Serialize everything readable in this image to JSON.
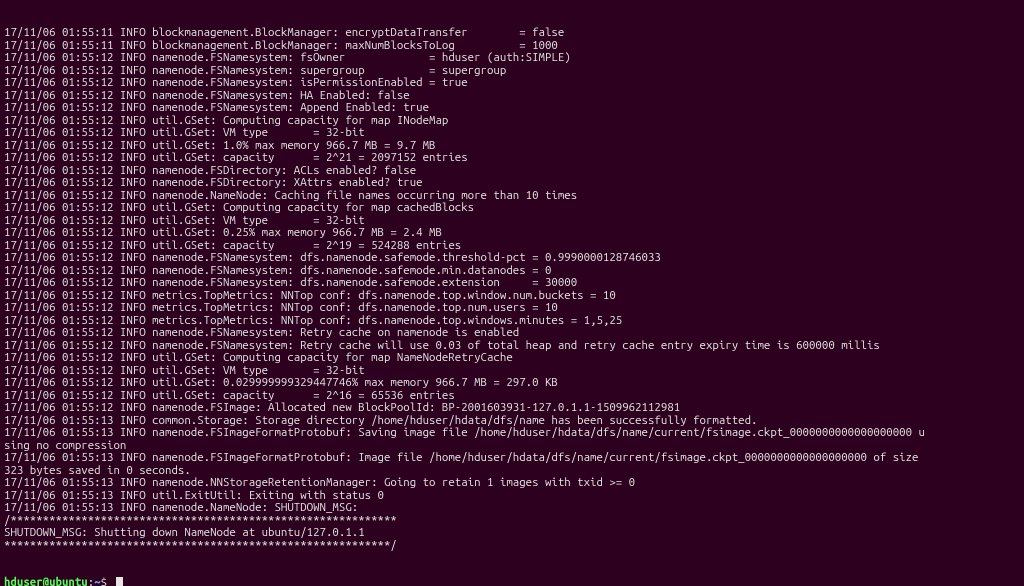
{
  "terminal": {
    "lines": [
      "17/11/06 01:55:11 INFO blockmanagement.BlockManager: encryptDataTransfer        = false",
      "17/11/06 01:55:11 INFO blockmanagement.BlockManager: maxNumBlocksToLog          = 1000",
      "17/11/06 01:55:12 INFO namenode.FSNamesystem: fsOwner             = hduser (auth:SIMPLE)",
      "17/11/06 01:55:12 INFO namenode.FSNamesystem: supergroup          = supergroup",
      "17/11/06 01:55:12 INFO namenode.FSNamesystem: isPermissionEnabled = true",
      "17/11/06 01:55:12 INFO namenode.FSNamesystem: HA Enabled: false",
      "17/11/06 01:55:12 INFO namenode.FSNamesystem: Append Enabled: true",
      "17/11/06 01:55:12 INFO util.GSet: Computing capacity for map INodeMap",
      "17/11/06 01:55:12 INFO util.GSet: VM type       = 32-bit",
      "17/11/06 01:55:12 INFO util.GSet: 1.0% max memory 966.7 MB = 9.7 MB",
      "17/11/06 01:55:12 INFO util.GSet: capacity      = 2^21 = 2097152 entries",
      "17/11/06 01:55:12 INFO namenode.FSDirectory: ACLs enabled? false",
      "17/11/06 01:55:12 INFO namenode.FSDirectory: XAttrs enabled? true",
      "17/11/06 01:55:12 INFO namenode.NameNode: Caching file names occurring more than 10 times",
      "17/11/06 01:55:12 INFO util.GSet: Computing capacity for map cachedBlocks",
      "17/11/06 01:55:12 INFO util.GSet: VM type       = 32-bit",
      "17/11/06 01:55:12 INFO util.GSet: 0.25% max memory 966.7 MB = 2.4 MB",
      "17/11/06 01:55:12 INFO util.GSet: capacity      = 2^19 = 524288 entries",
      "17/11/06 01:55:12 INFO namenode.FSNamesystem: dfs.namenode.safemode.threshold-pct = 0.9990000128746033",
      "17/11/06 01:55:12 INFO namenode.FSNamesystem: dfs.namenode.safemode.min.datanodes = 0",
      "17/11/06 01:55:12 INFO namenode.FSNamesystem: dfs.namenode.safemode.extension     = 30000",
      "17/11/06 01:55:12 INFO metrics.TopMetrics: NNTop conf: dfs.namenode.top.window.num.buckets = 10",
      "17/11/06 01:55:12 INFO metrics.TopMetrics: NNTop conf: dfs.namenode.top.num.users = 10",
      "17/11/06 01:55:12 INFO metrics.TopMetrics: NNTop conf: dfs.namenode.top.windows.minutes = 1,5,25",
      "17/11/06 01:55:12 INFO namenode.FSNamesystem: Retry cache on namenode is enabled",
      "17/11/06 01:55:12 INFO namenode.FSNamesystem: Retry cache will use 0.03 of total heap and retry cache entry expiry time is 600000 millis",
      "17/11/06 01:55:12 INFO util.GSet: Computing capacity for map NameNodeRetryCache",
      "17/11/06 01:55:12 INFO util.GSet: VM type       = 32-bit",
      "17/11/06 01:55:12 INFO util.GSet: 0.029999999329447746% max memory 966.7 MB = 297.0 KB",
      "17/11/06 01:55:12 INFO util.GSet: capacity      = 2^16 = 65536 entries",
      "17/11/06 01:55:12 INFO namenode.FSImage: Allocated new BlockPoolId: BP-2001603931-127.0.1.1-1509962112981",
      "17/11/06 01:55:13 INFO common.Storage: Storage directory /home/hduser/hdata/dfs/name has been successfully formatted.",
      "17/11/06 01:55:13 INFO namenode.FSImageFormatProtobuf: Saving image file /home/hduser/hdata/dfs/name/current/fsimage.ckpt_0000000000000000000 u",
      "sing no compression",
      "17/11/06 01:55:13 INFO namenode.FSImageFormatProtobuf: Image file /home/hduser/hdata/dfs/name/current/fsimage.ckpt_0000000000000000000 of size ",
      "323 bytes saved in 0 seconds.",
      "17/11/06 01:55:13 INFO namenode.NNStorageRetentionManager: Going to retain 1 images with txid >= 0",
      "17/11/06 01:55:13 INFO util.ExitUtil: Exiting with status 0",
      "17/11/06 01:55:13 INFO namenode.NameNode: SHUTDOWN_MSG:",
      "/************************************************************",
      "SHUTDOWN_MSG: Shutting down NameNode at ubuntu/127.0.1.1",
      "************************************************************/"
    ],
    "prompt": {
      "user": "hduser@ubuntu",
      "colon": ":",
      "path": "~",
      "dollar": "$ "
    }
  }
}
